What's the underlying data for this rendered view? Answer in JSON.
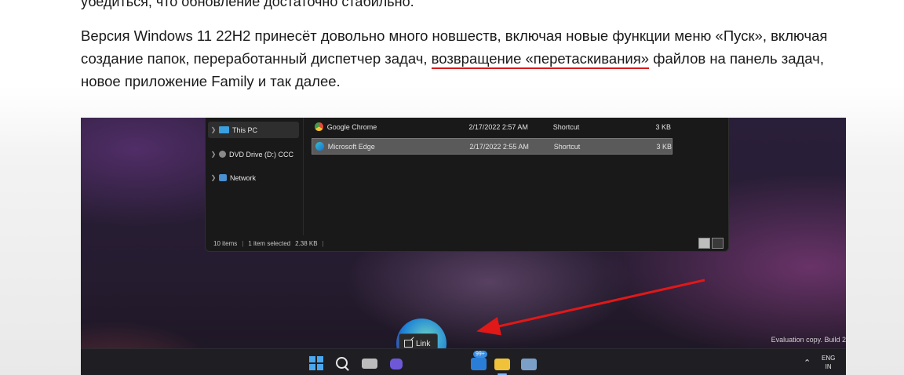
{
  "article": {
    "top_line_cropped": "убедиться, что обновление достаточно стабильно.",
    "paragraph_before": "Версия Windows 11 22H2 принесёт довольно много новшеств, включая новые функции меню «Пуск», включая создание папок, переработанный диспетчер задач, ",
    "paragraph_highlight": "возвращение «перетаскивания»",
    "paragraph_after": " файлов на панель задач, новое приложение Family и так далее.",
    "highlight_color": "#d81b1b"
  },
  "explorer": {
    "nav_items": [
      {
        "label": "This PC",
        "icon": "pc-icon",
        "selected": true
      },
      {
        "label": "DVD Drive (D:) CCC",
        "icon": "dvd-icon",
        "selected": false
      },
      {
        "label": "Network",
        "icon": "network-icon",
        "selected": false
      }
    ],
    "files": [
      {
        "name": "Google Chrome",
        "date": "2/17/2022 2:57 AM",
        "type": "Shortcut",
        "size": "3 KB",
        "icon": "chrome-icon",
        "selected": false
      },
      {
        "name": "Microsoft Edge",
        "date": "2/17/2022 2:55 AM",
        "type": "Shortcut",
        "size": "3 KB",
        "icon": "edge-icon",
        "selected": true
      }
    ],
    "status": {
      "items_count": "10 items",
      "selected": "1 item selected",
      "size": "2.38 KB"
    }
  },
  "desktop": {
    "watermark": "Evaluation copy. Build 2",
    "drag_tooltip": "Link"
  },
  "taskbar": {
    "widgets_badge": "99+",
    "lang_line1": "ENG",
    "lang_line2": "IN"
  },
  "annotation_arrow_color": "#e01818"
}
